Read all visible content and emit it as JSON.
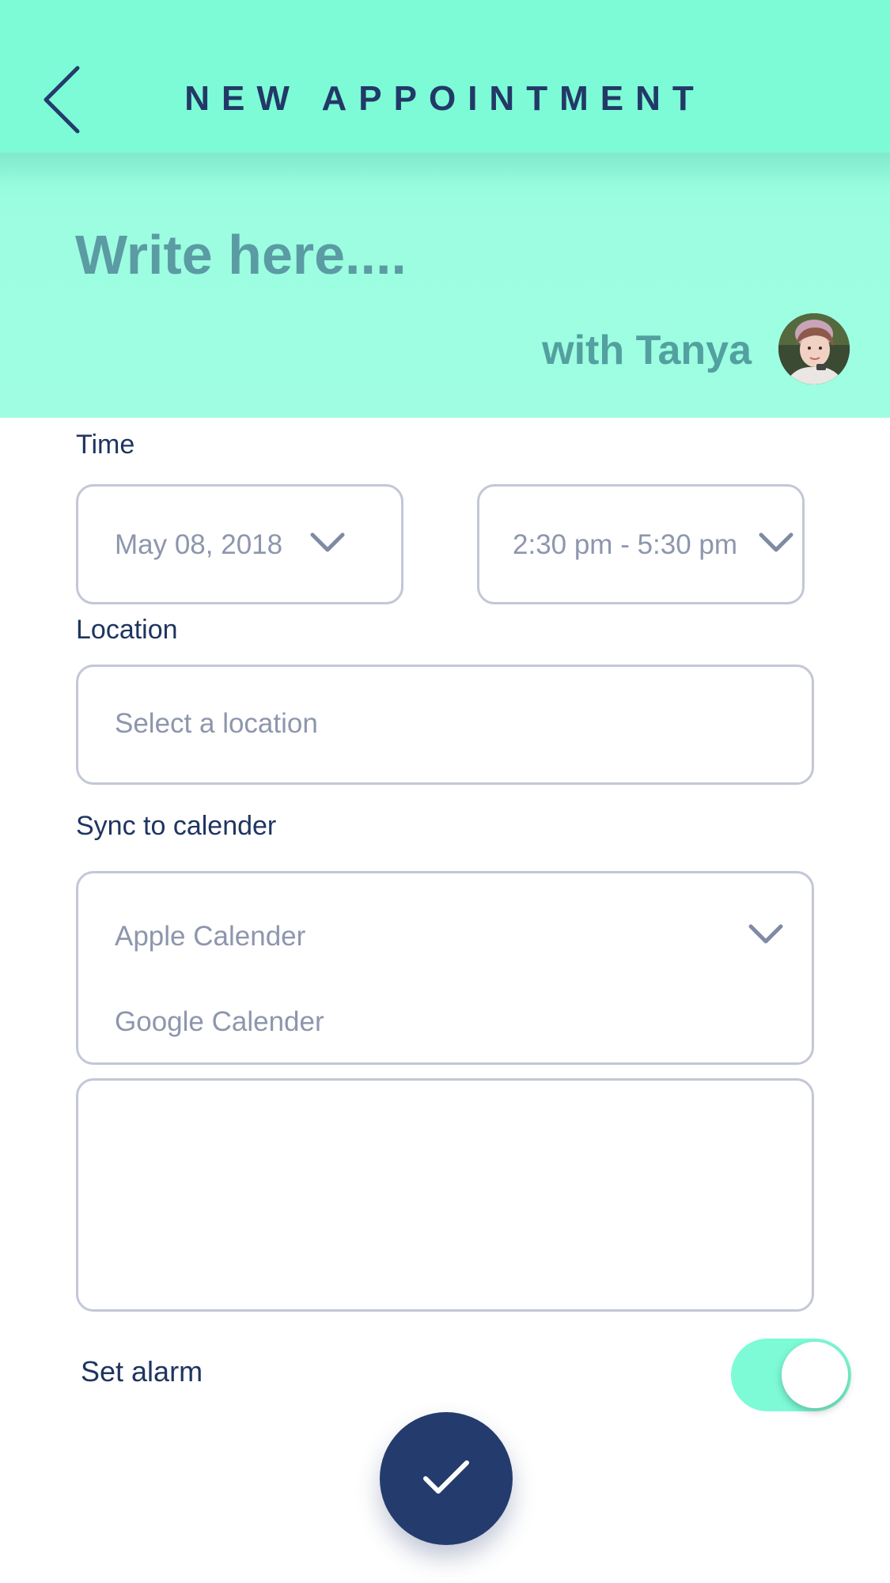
{
  "header": {
    "title": "NEW APPOINTMENT",
    "back_icon": "chevron-left-icon",
    "background_color": "#7dfbd6"
  },
  "hero": {
    "title_placeholder": "Write here....",
    "with_label": "with Tanya",
    "avatar_icon": "avatar-photo"
  },
  "form": {
    "time_label": "Time",
    "date_value": "May 08, 2018",
    "time_range_value": "2:30 pm - 5:30 pm",
    "location_label": "Location",
    "location_placeholder": "Select a location",
    "sync_label": "Sync to calender",
    "calendar_options": [
      "Apple Calender",
      "Google Calender"
    ],
    "notes_value": "",
    "alarm_label": "Set alarm",
    "alarm_on": true
  },
  "actions": {
    "confirm_icon": "check-icon",
    "confirm_color": "#243b6d"
  },
  "colors": {
    "accent": "#7dfbd6",
    "text_dark": "#1f3560",
    "placeholder": "#8d96ad",
    "field_border": "#c3c7d6"
  }
}
